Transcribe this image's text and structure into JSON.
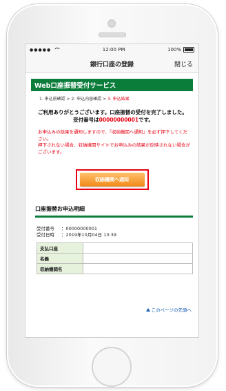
{
  "status_bar": {
    "time": "12:00 PM",
    "battery": "100%"
  },
  "nav": {
    "title": "銀行口座の登録",
    "close_label": "閉じる"
  },
  "service_title": "Web口座振替受付サービス",
  "steps": [
    {
      "label": "1. 申込前確認 > ",
      "current": false
    },
    {
      "label": "2. 申込内容確認 > ",
      "current": false
    },
    {
      "label": "3. 申込結果",
      "current": true
    }
  ],
  "thanks": {
    "line1": "ご利用ありがとうございます。口座振替の受付を完了しました。",
    "number_prefix": "受付番号は",
    "number": "00000000001",
    "number_suffix": "です。"
  },
  "notice": {
    "line1": "お申込みの結果を通知しますので、『収納機関へ通知』を必ず押下してください。",
    "line2": "押下されない場合、収納機関サイトでお申込みの結果が反映されない場合がございます。"
  },
  "notify_button": "収納機関へ通知",
  "details": {
    "title": "口座振替お申込明細",
    "receipt_label": "受付番号",
    "receipt_value": "：00000000001",
    "datetime_label": "受付日時",
    "datetime_value": "：2019年10月04日 13:39",
    "rows": [
      {
        "label": "支払口座",
        "value": ""
      },
      {
        "label": "名義",
        "value": ""
      },
      {
        "label": "収納機関名",
        "value": ""
      }
    ]
  },
  "back_to_top": "このページの先頭へ"
}
